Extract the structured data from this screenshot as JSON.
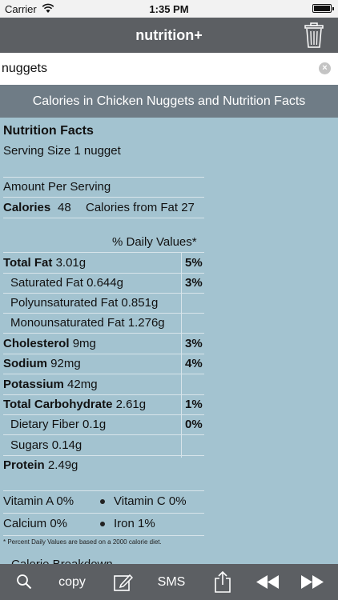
{
  "status": {
    "carrier": "Carrier",
    "time": "1:35 PM"
  },
  "nav": {
    "title": "nutrition+"
  },
  "search": {
    "value": "nuggets"
  },
  "header": {
    "title": "Calories in Chicken Nuggets and Nutrition Facts"
  },
  "facts": {
    "heading": "Nutrition Facts",
    "serving": "Serving Size 1 nugget",
    "amount_per_serving": "Amount Per Serving",
    "calories_label": "Calories",
    "calories_value": "48",
    "calories_from_fat": "Calories from Fat 27",
    "daily_values_header": "% Daily Values*",
    "rows": [
      {
        "label": "Total Fat",
        "value": "3.01g",
        "dv": "5%"
      },
      {
        "label": "Saturated Fat",
        "value": "0.644g",
        "dv": "3%"
      },
      {
        "label": "Polyunsaturated Fat",
        "value": "0.851g",
        "dv": ""
      },
      {
        "label": "Monounsaturated Fat",
        "value": "1.276g",
        "dv": ""
      },
      {
        "label": "Cholesterol",
        "value": "9mg",
        "dv": "3%"
      },
      {
        "label": "Sodium",
        "value": "92mg",
        "dv": "4%"
      },
      {
        "label": "Potassium",
        "value": "42mg",
        "dv": ""
      },
      {
        "label": "Total Carbohydrate",
        "value": "2.61g",
        "dv": "1%"
      },
      {
        "label": "Dietary Fiber",
        "value": "0.1g",
        "dv": "0%"
      },
      {
        "label": "Sugars",
        "value": "0.14g",
        "dv": ""
      },
      {
        "label": "Protein",
        "value": "2.49g",
        "dv": ""
      }
    ],
    "vitamin_a": "Vitamin A 0%",
    "vitamin_c": "Vitamin C 0%",
    "calcium": "Calcium 0%",
    "iron": "Iron 1%",
    "footnote": "* Percent Daily Values are based on a 2000 calorie diet.",
    "calorie_breakdown": "Calorie Breakdown"
  },
  "toolbar": {
    "copy_label": "copy",
    "sms_label": "SMS"
  },
  "icons": [
    "wifi-icon",
    "battery-icon",
    "trash-icon",
    "clear-icon",
    "search-icon",
    "edit-icon",
    "share-icon",
    "rewind-icon",
    "fast-forward-icon"
  ]
}
